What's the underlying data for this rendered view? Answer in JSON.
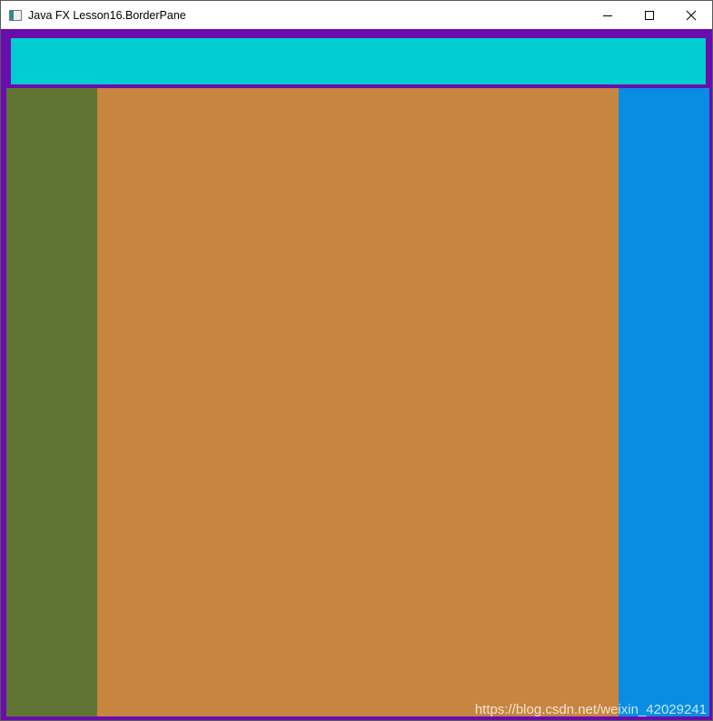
{
  "window": {
    "title": "Java FX Lesson16.BorderPane",
    "icon": "app-window-icon",
    "controls": {
      "minimize_icon": "minimize-icon",
      "maximize_icon": "maximize-icon",
      "close_icon": "close-icon"
    }
  },
  "border_pane": {
    "background_color": "#6a0dad",
    "top_color": "#00cdd1",
    "left_color": "#607434",
    "center_color": "#c7853f",
    "right_color": "#088de3"
  },
  "watermark": "https://blog.csdn.net/weixin_42029241"
}
